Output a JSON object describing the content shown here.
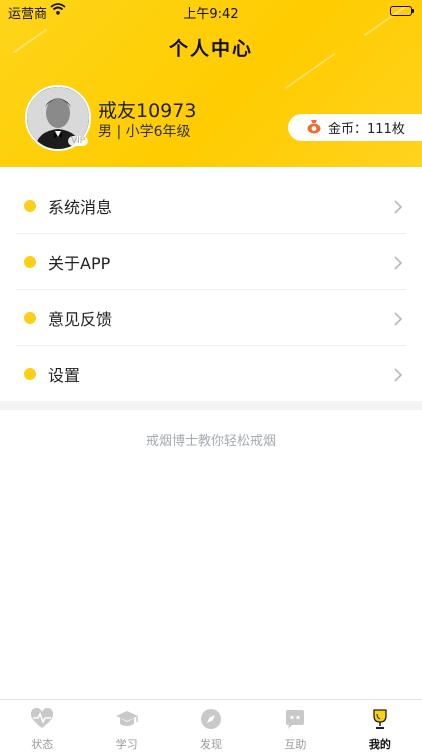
{
  "status_bar": {
    "carrier": "运营商",
    "time": "上午9:42",
    "battery_level": 1.0
  },
  "header": {
    "title": "个人中心",
    "gradient_colors": [
      "#fed51a",
      "#ffcc00"
    ]
  },
  "profile": {
    "username": "戒友10973",
    "info": "男 | 小学6年级",
    "vip_label": "VIP",
    "coins_label": "金币：111枚"
  },
  "menu": {
    "items": [
      {
        "label": "系统消息",
        "icon": "yellow-dot"
      },
      {
        "label": "关于APP",
        "icon": "yellow-dot"
      },
      {
        "label": "意见反馈",
        "icon": "yellow-dot"
      },
      {
        "label": "设置",
        "icon": "yellow-dot"
      }
    ]
  },
  "slogan": "戒烟博士教你轻松戒烟",
  "tabs": [
    {
      "label": "状态",
      "icon": "heartbeat-icon",
      "active": false
    },
    {
      "label": "学习",
      "icon": "graduation-cap-icon",
      "active": false
    },
    {
      "label": "发现",
      "icon": "compass-icon",
      "active": false
    },
    {
      "label": "互助",
      "icon": "chat-bubble-icon",
      "active": false
    },
    {
      "label": "我的",
      "icon": "trophy-icon",
      "active": true
    }
  ],
  "colors": {
    "accent": "#fbd017",
    "tab_inactive": "#9a9a9a",
    "tab_active": "#111111"
  }
}
